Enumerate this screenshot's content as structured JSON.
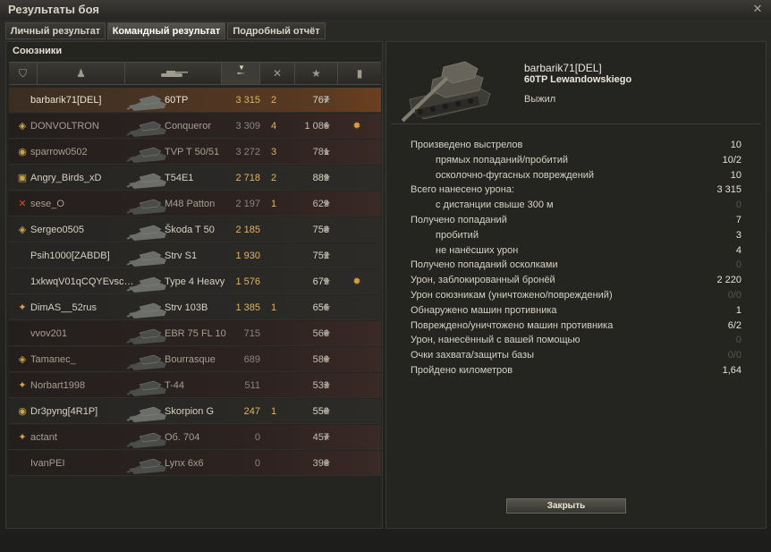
{
  "window": {
    "title": "Результаты боя"
  },
  "tabs": [
    {
      "label": "Личный результат"
    },
    {
      "label": "Командный результат"
    },
    {
      "label": "Подробный отчёт"
    }
  ],
  "team": {
    "label": "Союзники",
    "rows": [
      {
        "badge": "",
        "name": "barbarik71[DEL]",
        "vehicle": "60TP",
        "damage": "3 315",
        "kills": "2",
        "xp": "767",
        "medal": "",
        "highlight": true,
        "dim": false
      },
      {
        "badge": "◈",
        "name": "DONVOLTRON",
        "vehicle": "Conqueror",
        "damage": "3 309",
        "kills": "4",
        "xp": "1 086",
        "medal": "✹",
        "highlight": false,
        "dim": true
      },
      {
        "badge": "◉",
        "name": "sparrow0502",
        "vehicle": "TVP T 50/51",
        "damage": "3 272",
        "kills": "3",
        "xp": "781",
        "medal": "",
        "highlight": false,
        "dim": true
      },
      {
        "badge": "▣",
        "name": "Angry_Birds_xD",
        "vehicle": "T54E1",
        "damage": "2 718",
        "kills": "2",
        "xp": "889",
        "medal": "",
        "highlight": false,
        "dim": false
      },
      {
        "badge": "✕",
        "name": "sese_O",
        "vehicle": "M48 Patton",
        "damage": "2 197",
        "kills": "1",
        "xp": "629",
        "medal": "",
        "highlight": false,
        "dim": true
      },
      {
        "badge": "◈",
        "name": "Sergeo0505",
        "vehicle": "Škoda T 50",
        "damage": "2 185",
        "kills": "",
        "xp": "758",
        "medal": "",
        "highlight": false,
        "dim": false
      },
      {
        "badge": "",
        "name": "Psih1000[ZABDB]",
        "vehicle": "Strv S1",
        "damage": "1 930",
        "kills": "",
        "xp": "752",
        "medal": "",
        "highlight": false,
        "dim": false
      },
      {
        "badge": "",
        "name": "1xkwqV01qCQYEvsc…",
        "vehicle": "Type 4 Heavy",
        "damage": "1 576",
        "kills": "",
        "xp": "679",
        "medal": "✹",
        "highlight": false,
        "dim": false
      },
      {
        "badge": "✦",
        "name": "DimAS__52rus",
        "vehicle": "Strv 103B",
        "damage": "1 385",
        "kills": "1",
        "xp": "656",
        "medal": "",
        "highlight": false,
        "dim": false
      },
      {
        "badge": "",
        "name": "vvov201",
        "vehicle": "EBR 75 FL 10",
        "damage": "715",
        "kills": "",
        "xp": "560",
        "medal": "",
        "highlight": false,
        "dim": true
      },
      {
        "badge": "◈",
        "name": "Tamanec_",
        "vehicle": "Bourrasque",
        "damage": "689",
        "kills": "",
        "xp": "580",
        "medal": "",
        "highlight": false,
        "dim": true
      },
      {
        "badge": "✦",
        "name": "Norbart1998",
        "vehicle": "T-44",
        "damage": "511",
        "kills": "",
        "xp": "533",
        "medal": "",
        "highlight": false,
        "dim": true
      },
      {
        "badge": "◉",
        "name": "Dr3pyng[4R1P]",
        "vehicle": "Skorpion G",
        "damage": "247",
        "kills": "1",
        "xp": "550",
        "medal": "",
        "highlight": false,
        "dim": false
      },
      {
        "badge": "✦",
        "name": "actant",
        "vehicle": "Об. 704",
        "damage": "0",
        "kills": "",
        "xp": "457",
        "medal": "",
        "highlight": false,
        "dim": true
      },
      {
        "badge": "",
        "name": "IvanPEI",
        "vehicle": "Lynx 6x6",
        "damage": "0",
        "kills": "",
        "xp": "398",
        "medal": "",
        "highlight": false,
        "dim": true
      }
    ]
  },
  "player": {
    "name": "barbarik71[DEL]",
    "vehicle": "60TP Lewandowskiego",
    "status": "Выжил"
  },
  "stats": [
    {
      "label": "Произведено выстрелов",
      "value": "10",
      "indent": 0,
      "dim": false
    },
    {
      "label": "прямых попаданий/пробитий",
      "value": "10/2",
      "indent": 1,
      "dim": false
    },
    {
      "label": "осколочно-фугасных повреждений",
      "value": "10",
      "indent": 1,
      "dim": false
    },
    {
      "label": "Всего нанесено урона:",
      "value": "3 315",
      "indent": 0,
      "dim": false
    },
    {
      "label": "с дистанции свыше 300 м",
      "value": "0",
      "indent": 1,
      "dim": true
    },
    {
      "label": "Получено попаданий",
      "value": "7",
      "indent": 0,
      "dim": false
    },
    {
      "label": "пробитий",
      "value": "3",
      "indent": 1,
      "dim": false
    },
    {
      "label": "не нанёсших урон",
      "value": "4",
      "indent": 1,
      "dim": false
    },
    {
      "label": "Получено попаданий осколками",
      "value": "0",
      "indent": 0,
      "dim": true
    },
    {
      "label": "Урон, заблокированный бронёй",
      "value": "2 220",
      "indent": 0,
      "dim": false
    },
    {
      "label": "Урон союзникам (уничтожено/повреждений)",
      "value": "0/0",
      "indent": 0,
      "dim": true
    },
    {
      "label": "Обнаружено машин противника",
      "value": "1",
      "indent": 0,
      "dim": false
    },
    {
      "label": "Повреждено/уничтожено машин противника",
      "value": "6/2",
      "indent": 0,
      "dim": false
    },
    {
      "label": "Урон, нанесённый с вашей помощью",
      "value": "0",
      "indent": 0,
      "dim": true
    },
    {
      "label": "Очки захвата/защиты базы",
      "value": "0/0",
      "indent": 0,
      "dim": true
    },
    {
      "label": "Пройдено километров",
      "value": "1,64",
      "indent": 0,
      "dim": false
    }
  ],
  "close_button": {
    "label": "Закрыть"
  },
  "icons": {
    "star": "star-icon",
    "medal": "medal-icon",
    "close": "close-icon"
  }
}
